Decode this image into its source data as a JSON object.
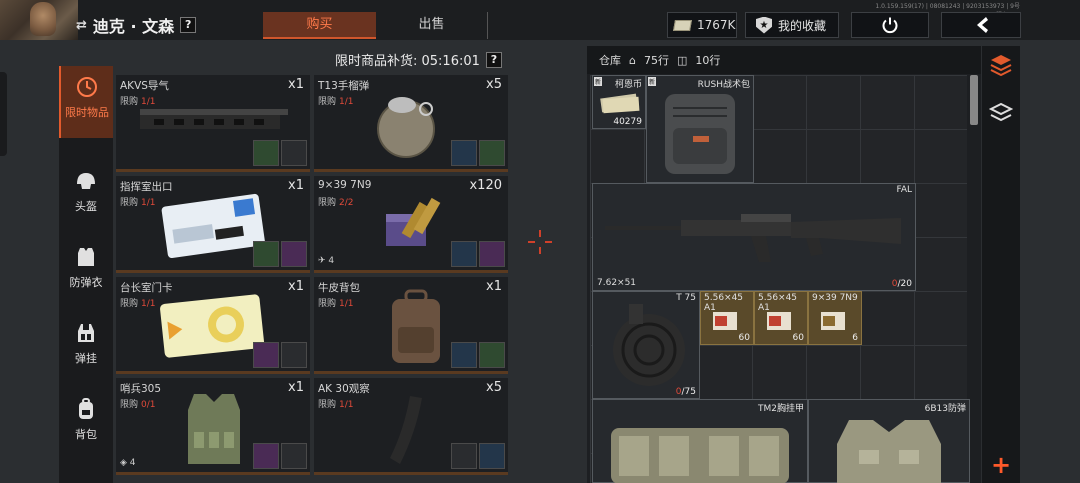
{
  "version_text": "1.0.159.159(17) | 08081243 | 9203153973 | 9号服务器-5",
  "player": {
    "name": "迪克 · 文森",
    "swap_icon": "swap-arrows-icon",
    "help": "?"
  },
  "tabs": {
    "buy": "购买",
    "sell": "出售"
  },
  "currency": {
    "amount": "1767K",
    "icon": "cash-icon"
  },
  "favorites_label": "我的收藏",
  "restock": {
    "label": "限时商品补货: 05:16:01",
    "help": "?"
  },
  "categories": [
    {
      "label": "限时物品",
      "icon": "clock-icon",
      "active": true
    },
    {
      "label": "头盔",
      "icon": "helmet-icon"
    },
    {
      "label": "防弹衣",
      "icon": "armor-vest-icon"
    },
    {
      "label": "弹挂",
      "icon": "chest-rig-icon"
    },
    {
      "label": "背包",
      "icon": "backpack-icon"
    }
  ],
  "shop_items": [
    {
      "name": "AKVS导气",
      "qty": "x1",
      "limit_label": "限购",
      "limit": "1/1",
      "icon": "handguard-rail-icon"
    },
    {
      "name": "T13手榴弹",
      "qty": "x5",
      "limit_label": "限购",
      "limit": "1/1",
      "icon": "grenade-icon"
    },
    {
      "name": "指挥室出口",
      "qty": "x1",
      "limit_label": "限购",
      "limit": "1/1",
      "icon": "keycard-blue-icon"
    },
    {
      "name": "9×39 7N9",
      "qty": "x120",
      "limit_label": "限购",
      "limit": "2/2",
      "icon": "ammo-box-icon",
      "note": "4"
    },
    {
      "name": "台长室门卡",
      "qty": "x1",
      "limit_label": "限购",
      "limit": "1/1",
      "icon": "keycard-yellow-icon"
    },
    {
      "name": "牛皮背包",
      "qty": "x1",
      "limit_label": "限购",
      "limit": "1/1",
      "icon": "leather-backpack-icon"
    },
    {
      "name": "哨兵305",
      "qty": "x1",
      "limit_label": "限购",
      "limit": "0/1",
      "icon": "camo-vest-icon",
      "note": "4"
    },
    {
      "name": "AK 30观察",
      "qty": "x5",
      "limit_label": "限购",
      "limit": "1/1",
      "icon": "ak-magazine-icon"
    }
  ],
  "inventory": {
    "label": "仓库",
    "rows_home": "75行",
    "rows_bag": "10行",
    "items": [
      {
        "label": "柯恩币",
        "count": "40279",
        "new": "新",
        "icon": "banknotes-icon"
      },
      {
        "label": "RUSH战术包",
        "new": "新",
        "icon": "tactical-backpack-icon"
      },
      {
        "label": "FAL",
        "caliber": "7.62×51",
        "ammo": "0",
        "ammo_max": "/20",
        "icon": "fal-rifle-icon"
      },
      {
        "label": "T 75",
        "ammo": "0",
        "ammo_max": "/75",
        "icon": "drum-magazine-icon"
      },
      {
        "label": "5.56×45 A1",
        "count": "60",
        "icon": "rifle-ammo-icon"
      },
      {
        "label": "5.56×45 A1",
        "count": "60",
        "icon": "rifle-ammo-icon"
      },
      {
        "label": "9×39 7N9",
        "count": "6",
        "icon": "rifle-ammo-icon"
      },
      {
        "label": "TM2胸挂甲",
        "icon": "camo-chest-rig-icon"
      },
      {
        "label": "6B13防弹",
        "icon": "camo-armor-icon"
      }
    ]
  },
  "colors": {
    "accent": "#e25a2c",
    "limit_red": "#e04a3a",
    "active_tab_bg": "#6a3320"
  }
}
